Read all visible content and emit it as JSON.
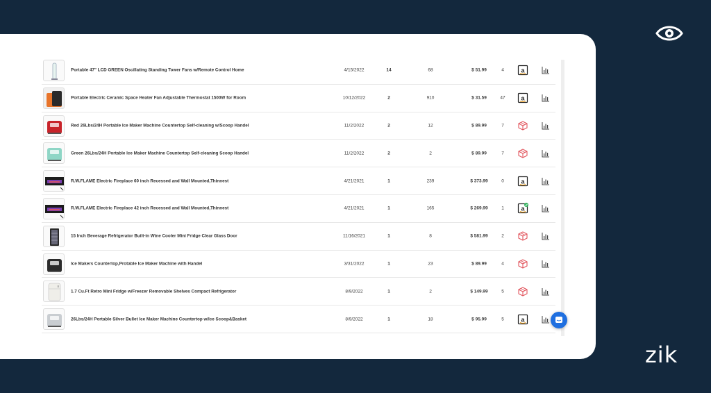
{
  "brand": {
    "name": "zik",
    "logo_icon": "eye-icon"
  },
  "products": [
    {
      "title": "Portable 47\" LCD GREEN Oscillating Standing Tower Fans w/Remote Control Home",
      "date": "4/15/2022",
      "sales": "14",
      "reviews": "68",
      "price": "$ 51.99",
      "count": "4",
      "supplier": "amazon",
      "verified": false,
      "thumb": "tower-fan",
      "thumb_color": "#e8f4f0"
    },
    {
      "title": "Portable Electric Ceramic Space Heater Fan Adjustable Thermostat 1500W for Room",
      "date": "10/12/2022",
      "sales": "2",
      "reviews": "910",
      "price": "$ 31.59",
      "count": "47",
      "supplier": "amazon",
      "verified": false,
      "thumb": "heater",
      "thumb_color": "#e8742a"
    },
    {
      "title": "Red 26Lbs/24H Portable Ice Maker Machine Countertop Self-cleaning w/Scoop Handel",
      "date": "11/2/2022",
      "sales": "2",
      "reviews": "12",
      "price": "$ 89.99",
      "count": "7",
      "supplier": "box",
      "verified": false,
      "thumb": "ice-maker",
      "thumb_color": "#c8232a"
    },
    {
      "title": "Green 26Lbs/24H Portable Ice Maker Machine Countertop Self-cleaning Scoop Handel",
      "date": "11/2/2022",
      "sales": "2",
      "reviews": "2",
      "price": "$ 89.99",
      "count": "7",
      "supplier": "box",
      "verified": false,
      "thumb": "ice-maker",
      "thumb_color": "#8fd6c6"
    },
    {
      "title": "R.W.FLAME Electric Fireplace 60 inch Recessed and Wall Mounted,Thinnest",
      "date": "4/21/2021",
      "sales": "1",
      "reviews": "239",
      "price": "$ 373.99",
      "count": "0",
      "supplier": "amazon",
      "verified": false,
      "thumb": "fireplace",
      "thumb_color": "#1b1b1b"
    },
    {
      "title": "R.W.FLAME Electric Fireplace 42 inch Recessed and Wall Mounted,Thinnest",
      "date": "4/21/2021",
      "sales": "1",
      "reviews": "165",
      "price": "$ 269.99",
      "count": "1",
      "supplier": "amazon",
      "verified": true,
      "thumb": "fireplace",
      "thumb_color": "#1b1b1b"
    },
    {
      "title": "15 Inch Beverage Refrigerator Built-in Wine Cooler Mini Fridge Clear Glass Door",
      "date": "11/16/2021",
      "sales": "1",
      "reviews": "8",
      "price": "$ 581.99",
      "count": "2",
      "supplier": "box",
      "verified": false,
      "thumb": "wine-fridge",
      "thumb_color": "#2a2a2a"
    },
    {
      "title": "Ice Makers Countertop,Protable Ice Maker Machine with Handel",
      "date": "3/31/2022",
      "sales": "1",
      "reviews": "23",
      "price": "$ 89.99",
      "count": "4",
      "supplier": "box",
      "verified": false,
      "thumb": "ice-maker",
      "thumb_color": "#2b2b2b"
    },
    {
      "title": "1.7 Cu.Ft Retro Mini Fridge w/Freezer Removable Shelves Compact Refrigerator",
      "date": "8/9/2022",
      "sales": "1",
      "reviews": "2",
      "price": "$ 149.99",
      "count": "5",
      "supplier": "box",
      "verified": false,
      "thumb": "mini-fridge",
      "thumb_color": "#efeee9"
    },
    {
      "title": "26Lbs/24H Portable Silver Bullet Ice Maker Machine Countertop w/Ice Scoop&Basket",
      "date": "8/9/2022",
      "sales": "1",
      "reviews": "18",
      "price": "$ 95.99",
      "count": "5",
      "supplier": "amazon",
      "verified": false,
      "thumb": "ice-maker",
      "thumb_color": "#c9cdd1"
    }
  ],
  "chat": {
    "icon": "chat-icon",
    "color": "#1f6fe0"
  }
}
